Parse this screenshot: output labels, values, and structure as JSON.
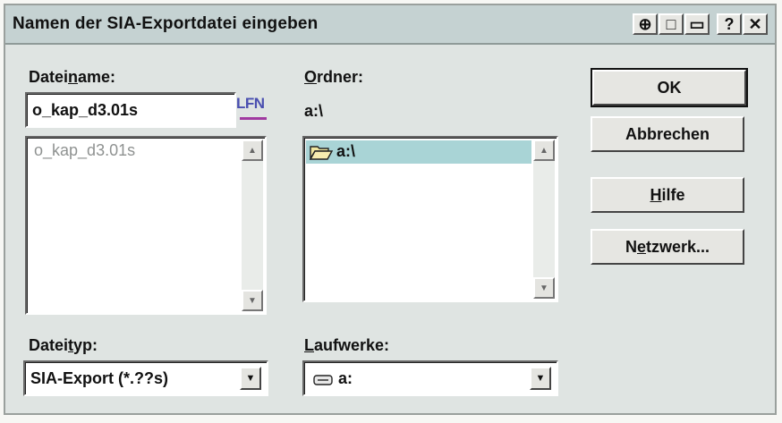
{
  "window": {
    "title": "Namen der SIA-Exportdatei eingeben",
    "title_buttons": [
      "⊕",
      "□",
      "▭",
      "?",
      "✕"
    ]
  },
  "filename": {
    "label_pre": "Datei",
    "label_u": "n",
    "label_post": "ame:",
    "value": "o_kap_d3.01s",
    "lfn_badge": "LFN",
    "list_items": [
      "o_kap_d3.01s"
    ]
  },
  "folder": {
    "label_u": "O",
    "label_post": "rdner:",
    "current_path": "a:\\",
    "list_items": [
      "a:\\"
    ]
  },
  "filetype": {
    "label_pre": "Datei",
    "label_u": "t",
    "label_post": "yp:",
    "selected": "SIA-Export (*.??s)"
  },
  "drives": {
    "label_u": "L",
    "label_post": "aufwerke:",
    "selected": "a:"
  },
  "buttons": {
    "ok": "OK",
    "cancel": "Abbrechen",
    "help_u": "H",
    "help_post": "ilfe",
    "network_pre": "N",
    "network_u": "e",
    "network_post": "tzwerk..."
  }
}
